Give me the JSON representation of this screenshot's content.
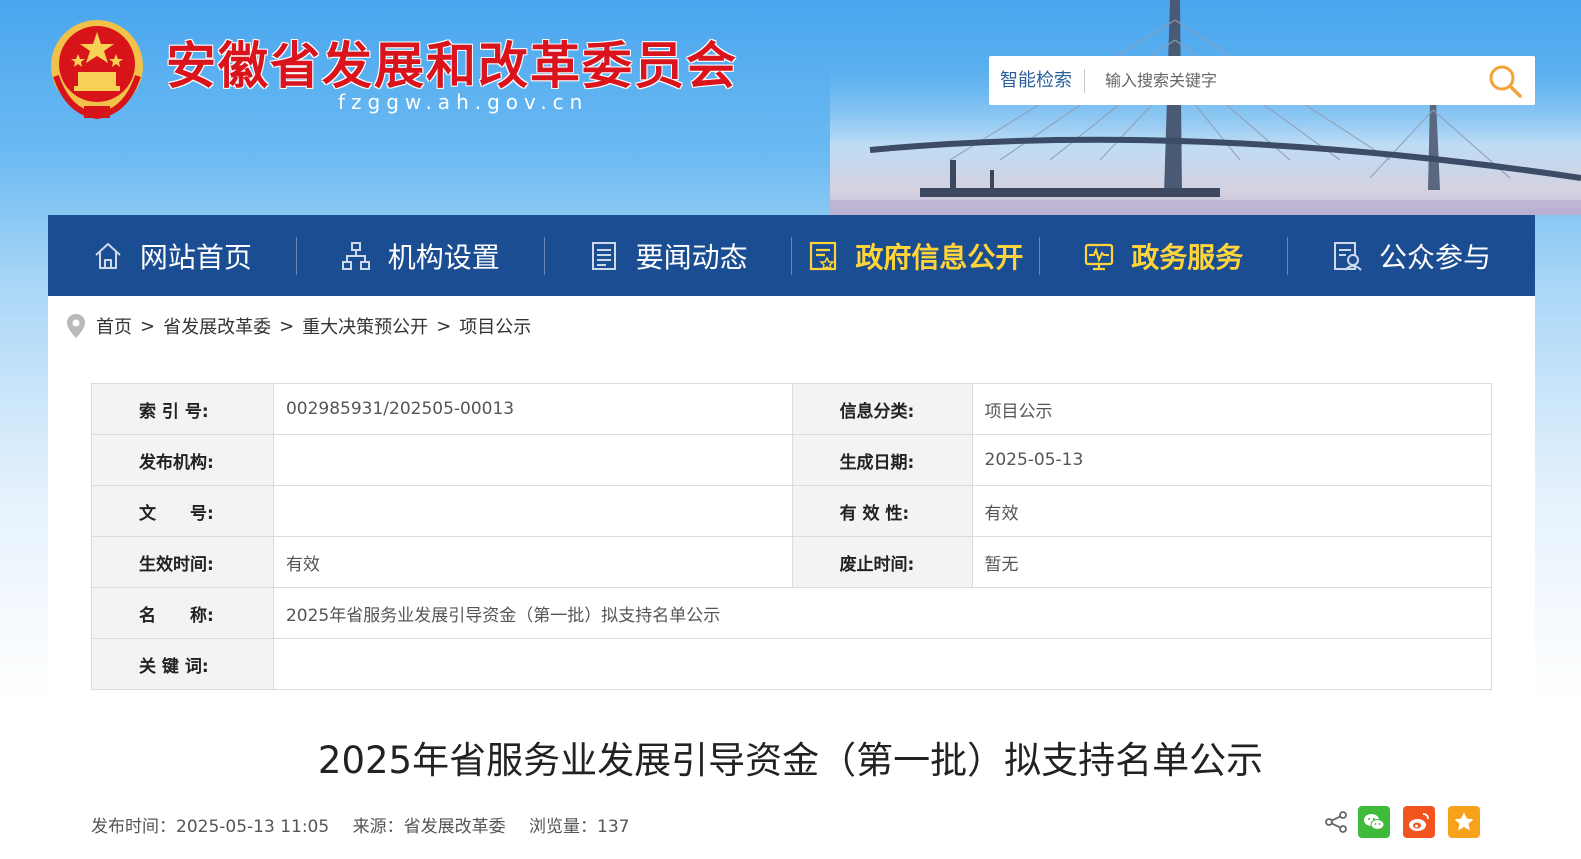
{
  "header": {
    "site_title": "安徽省发展和改革委员会",
    "site_domain": "fzggw.ah.gov.cn",
    "search": {
      "label": "智能检索",
      "placeholder": "输入搜索关键字"
    }
  },
  "nav": {
    "items": [
      {
        "label": "网站首页",
        "icon": "home-icon",
        "highlight": false
      },
      {
        "label": "机构设置",
        "icon": "org-chart-icon",
        "highlight": false
      },
      {
        "label": "要闻动态",
        "icon": "news-icon",
        "highlight": false
      },
      {
        "label": "政府信息公开",
        "icon": "document-icon",
        "highlight": true
      },
      {
        "label": "政务服务",
        "icon": "monitor-icon",
        "highlight": true
      },
      {
        "label": "公众参与",
        "icon": "survey-icon",
        "highlight": false
      }
    ],
    "highlight_color": "#ffd43a",
    "background": "#1b4d93"
  },
  "breadcrumb": [
    "首页",
    "省发展改革委",
    "重大决策预公开",
    "项目公示"
  ],
  "meta_table": {
    "index_label": "索 引 号:",
    "index_value": "002985931/202505-00013",
    "category_label": "信息分类:",
    "category_value": "项目公示",
    "publisher_label": "发布机构:",
    "publisher_value": "",
    "date_label": "生成日期:",
    "date_value": "2025-05-13",
    "docno_label": "文　　号:",
    "docno_value": "",
    "validity_label": "有 效 性:",
    "validity_value": "有效",
    "effective_label": "生效时间:",
    "effective_value": "有效",
    "abolish_label": "废止时间:",
    "abolish_value": "暂无",
    "name_label": "名　　称:",
    "name_value": "2025年省服务业发展引导资金（第一批）拟支持名单公示",
    "keywords_label": "关 键 词:",
    "keywords_value": ""
  },
  "article": {
    "title": "2025年省服务业发展引导资金（第一批）拟支持名单公示",
    "publish_time": "发布时间：2025-05-13 11:05",
    "source": "来源：省发展改革委",
    "views": "浏览量：137"
  },
  "share": {
    "icons": [
      "share-icon",
      "wechat-icon",
      "weibo-icon",
      "favorite-icon"
    ]
  },
  "colors": {
    "title_red": "#d9141c",
    "nav_blue": "#1b4d93",
    "wechat_green": "#3fba3b",
    "weibo_orange": "#f2531f",
    "favorite_orange": "#f7a21b"
  }
}
